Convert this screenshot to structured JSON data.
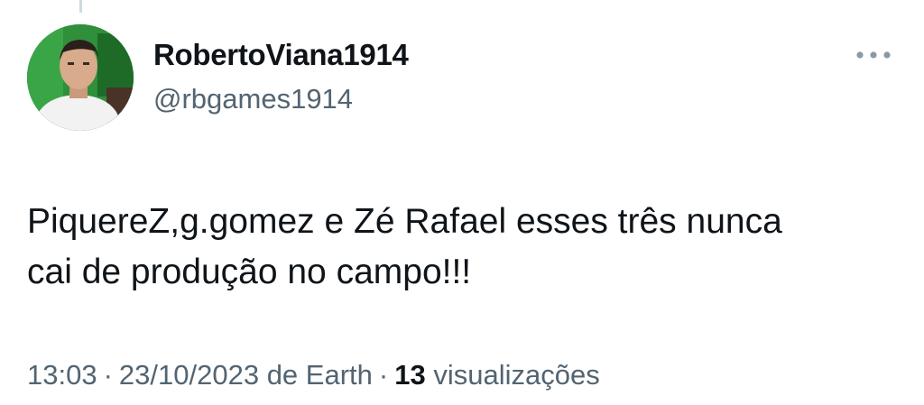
{
  "tweet": {
    "author": {
      "display_name": "RobertoViana1914",
      "handle": "@rbgames1914",
      "avatar_icon": "profile-photo"
    },
    "text_lines": [
      "PiquereZ,g.gomez e Zé Rafael esses três nunca",
      "cai de produção no campo!!!"
    ],
    "meta": {
      "time": "13:03",
      "separator": "·",
      "date": "23/10/2023",
      "source_prefix": "de",
      "source": "Earth",
      "views_count": "13",
      "views_label": "visualizações"
    },
    "more_icon": "more-horizontal-icon"
  },
  "colors": {
    "text_primary": "#0f1419",
    "text_secondary": "#536471",
    "avatar_background": "#2f8f3a"
  }
}
